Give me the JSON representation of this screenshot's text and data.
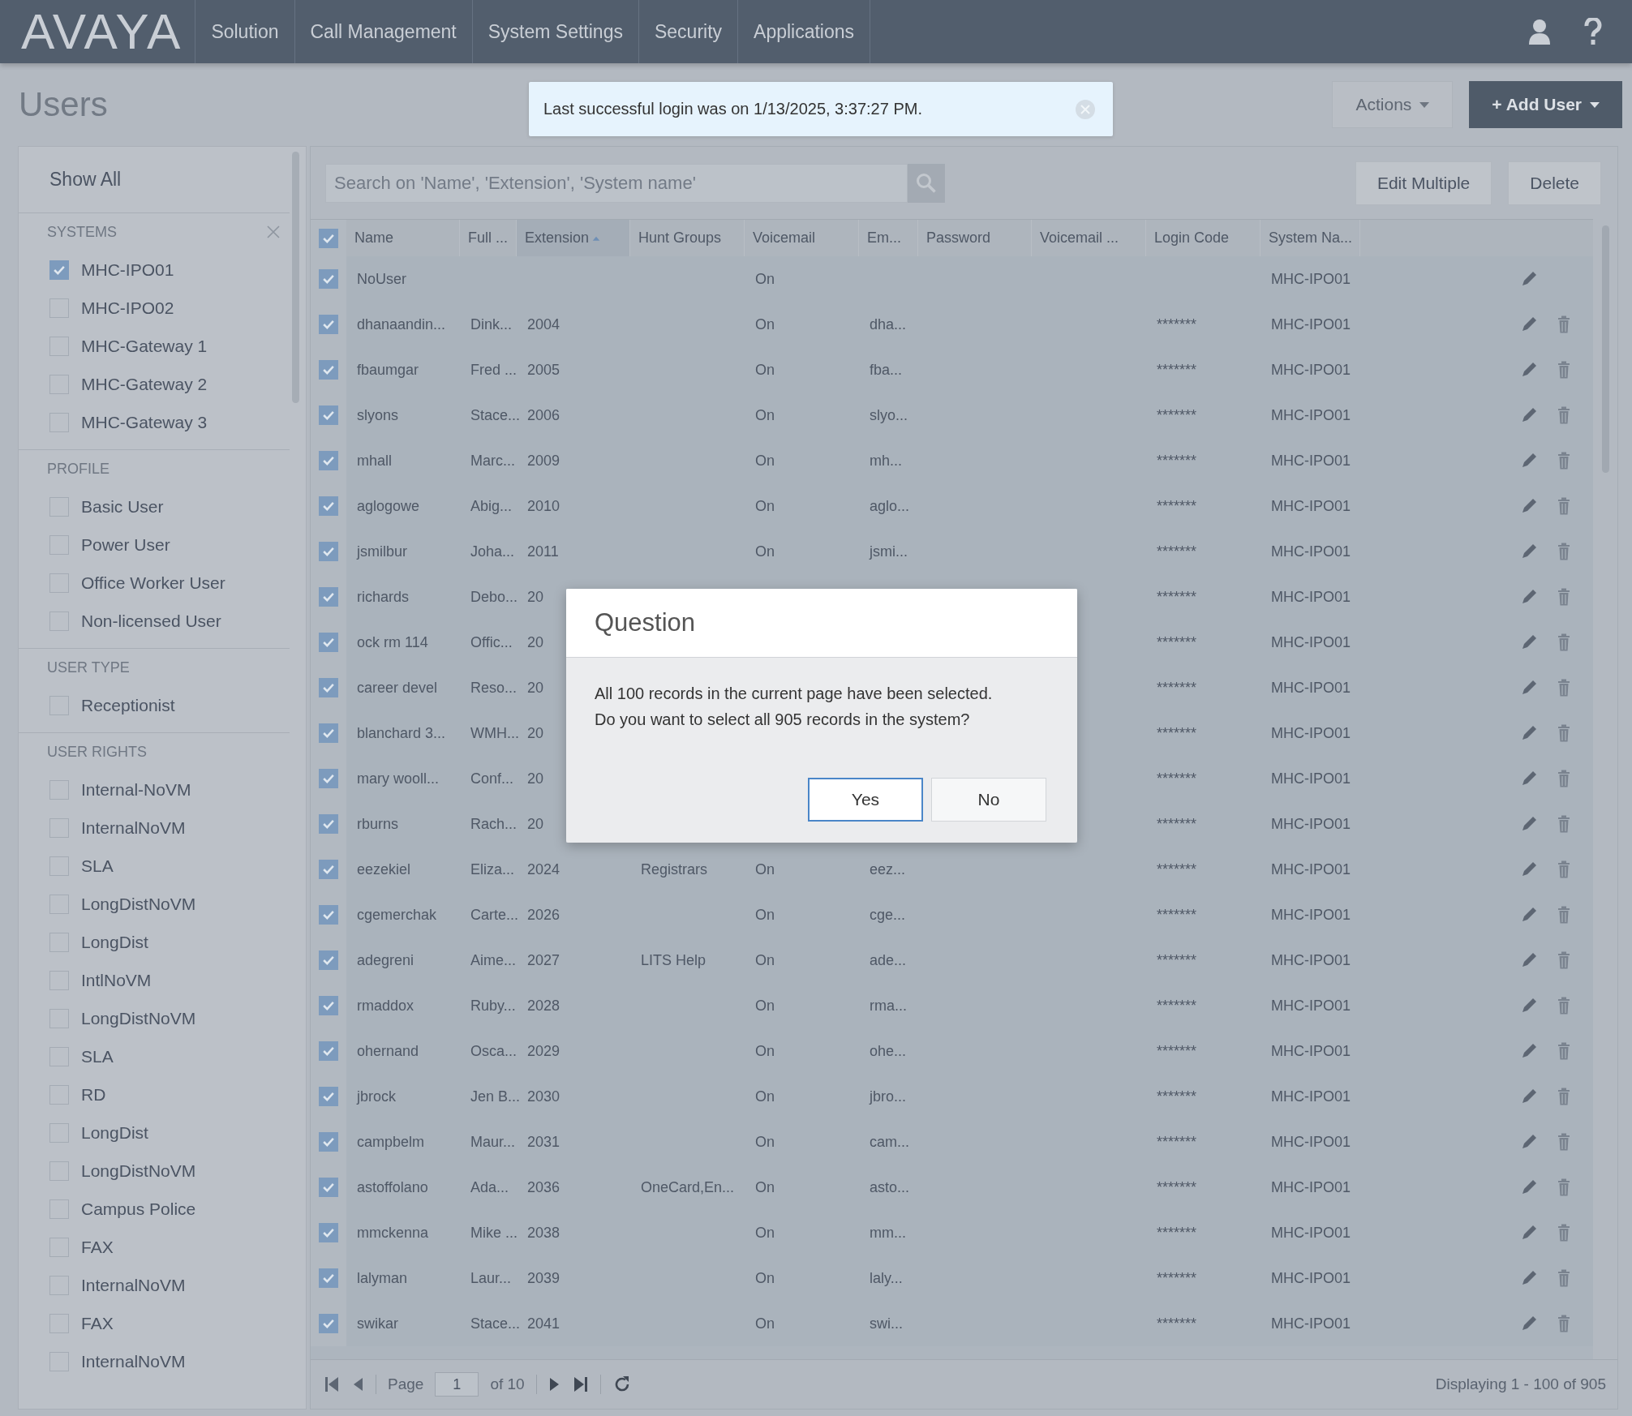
{
  "topbar": {
    "logo": "AVAYA",
    "nav": [
      {
        "label": "Solution"
      },
      {
        "label": "Call Management"
      },
      {
        "label": "System Settings"
      },
      {
        "label": "Security"
      },
      {
        "label": "Applications"
      }
    ]
  },
  "page_title": "Users",
  "notification": {
    "message": "Last successful login was on 1/13/2025, 3:37:27 PM."
  },
  "header_buttons": [
    {
      "label": "Actions",
      "kind": "secondary"
    },
    {
      "label": "+ Add User",
      "kind": "primary"
    }
  ],
  "sidebar": {
    "show_all": "Show All",
    "sections": [
      {
        "title": "SYSTEMS",
        "clearable": true,
        "items": [
          {
            "label": "MHC-IPO01",
            "checked": true
          },
          {
            "label": "MHC-IPO02",
            "checked": false
          },
          {
            "label": "MHC-Gateway 1",
            "checked": false
          },
          {
            "label": "MHC-Gateway 2",
            "checked": false
          },
          {
            "label": "MHC-Gateway 3",
            "checked": false
          }
        ]
      },
      {
        "title": "PROFILE",
        "clearable": false,
        "items": [
          {
            "label": "Basic User",
            "checked": false
          },
          {
            "label": "Power User",
            "checked": false
          },
          {
            "label": "Office Worker User",
            "checked": false
          },
          {
            "label": "Non-licensed User",
            "checked": false
          }
        ]
      },
      {
        "title": "USER TYPE",
        "clearable": false,
        "items": [
          {
            "label": "Receptionist",
            "checked": false
          }
        ]
      },
      {
        "title": "USER RIGHTS",
        "clearable": false,
        "items": [
          {
            "label": "Internal-NoVM",
            "checked": false
          },
          {
            "label": "InternalNoVM",
            "checked": false
          },
          {
            "label": "SLA",
            "checked": false
          },
          {
            "label": "LongDistNoVM",
            "checked": false
          },
          {
            "label": "LongDist",
            "checked": false
          },
          {
            "label": "IntlNoVM",
            "checked": false
          },
          {
            "label": "LongDistNoVM",
            "checked": false
          },
          {
            "label": "SLA",
            "checked": false
          },
          {
            "label": "RD",
            "checked": false
          },
          {
            "label": "LongDist",
            "checked": false
          },
          {
            "label": "LongDistNoVM",
            "checked": false
          },
          {
            "label": "Campus Police",
            "checked": false
          },
          {
            "label": "FAX",
            "checked": false
          },
          {
            "label": "InternalNoVM",
            "checked": false
          },
          {
            "label": "FAX",
            "checked": false
          },
          {
            "label": "InternalNoVM",
            "checked": false
          }
        ]
      }
    ]
  },
  "search": {
    "placeholder": "Search on 'Name', 'Extension', 'System name'"
  },
  "grid_buttons": [
    {
      "label": "Edit Multiple"
    },
    {
      "label": "Delete"
    }
  ],
  "table": {
    "all_selected": true,
    "columns": [
      {
        "label": "Name",
        "sorted_ascending": false
      },
      {
        "label": "Full ...",
        "sorted_ascending": false
      },
      {
        "label": "Extension",
        "sorted_ascending": true
      },
      {
        "label": "Hunt Groups",
        "sorted_ascending": false
      },
      {
        "label": "Voicemail",
        "sorted_ascending": false
      },
      {
        "label": "Em...",
        "sorted_ascending": false
      },
      {
        "label": "Password",
        "sorted_ascending": false
      },
      {
        "label": "Voicemail ...",
        "sorted_ascending": false
      },
      {
        "label": "Login Code",
        "sorted_ascending": false
      },
      {
        "label": "System Na...",
        "sorted_ascending": false
      }
    ],
    "rows": [
      {
        "selected": true,
        "deletable": false,
        "cells": [
          "NoUser",
          "",
          "",
          "",
          "On",
          "",
          "",
          "",
          "",
          "MHC-IPO01"
        ]
      },
      {
        "selected": true,
        "deletable": true,
        "cells": [
          "dhanaandin...",
          "Dink...",
          "2004",
          "",
          "On",
          "dha...",
          "",
          "",
          "*******",
          "MHC-IPO01"
        ]
      },
      {
        "selected": true,
        "deletable": true,
        "cells": [
          "fbaumgar",
          "Fred ...",
          "2005",
          "",
          "On",
          "fba...",
          "",
          "",
          "*******",
          "MHC-IPO01"
        ]
      },
      {
        "selected": true,
        "deletable": true,
        "cells": [
          "slyons",
          "Stace...",
          "2006",
          "",
          "On",
          "slyo...",
          "",
          "",
          "*******",
          "MHC-IPO01"
        ]
      },
      {
        "selected": true,
        "deletable": true,
        "cells": [
          "mhall",
          "Marc...",
          "2009",
          "",
          "On",
          "mh...",
          "",
          "",
          "*******",
          "MHC-IPO01"
        ]
      },
      {
        "selected": true,
        "deletable": true,
        "cells": [
          "aglogowe",
          "Abig...",
          "2010",
          "",
          "On",
          "aglo...",
          "",
          "",
          "*******",
          "MHC-IPO01"
        ]
      },
      {
        "selected": true,
        "deletable": true,
        "cells": [
          "jsmilbur",
          "Joha...",
          "2011",
          "",
          "On",
          "jsmi...",
          "",
          "",
          "*******",
          "MHC-IPO01"
        ]
      },
      {
        "selected": true,
        "deletable": true,
        "cells": [
          "richards",
          "Debo...",
          "20",
          "",
          "",
          "",
          "",
          "",
          "*******",
          "MHC-IPO01"
        ]
      },
      {
        "selected": true,
        "deletable": true,
        "cells": [
          "ock rm 114",
          "Offic...",
          "20",
          "",
          "",
          "",
          "",
          "",
          "*******",
          "MHC-IPO01"
        ]
      },
      {
        "selected": true,
        "deletable": true,
        "cells": [
          "career devel",
          "Reso...",
          "20",
          "",
          "",
          "",
          "",
          "",
          "*******",
          "MHC-IPO01"
        ]
      },
      {
        "selected": true,
        "deletable": true,
        "cells": [
          "blanchard 3...",
          "WMH...",
          "20",
          "",
          "",
          "",
          "",
          "",
          "*******",
          "MHC-IPO01"
        ]
      },
      {
        "selected": true,
        "deletable": true,
        "cells": [
          "mary wooll...",
          "Conf...",
          "20",
          "",
          "",
          "",
          "",
          "",
          "*******",
          "MHC-IPO01"
        ]
      },
      {
        "selected": true,
        "deletable": true,
        "cells": [
          "rburns",
          "Rach...",
          "20",
          "",
          "",
          "",
          "",
          "",
          "*******",
          "MHC-IPO01"
        ]
      },
      {
        "selected": true,
        "deletable": true,
        "cells": [
          "eezekiel",
          "Eliza...",
          "2024",
          "Registrars",
          "On",
          "eez...",
          "",
          "",
          "*******",
          "MHC-IPO01"
        ]
      },
      {
        "selected": true,
        "deletable": true,
        "cells": [
          "cgemerchak",
          "Carte...",
          "2026",
          "",
          "On",
          "cge...",
          "",
          "",
          "*******",
          "MHC-IPO01"
        ]
      },
      {
        "selected": true,
        "deletable": true,
        "cells": [
          "adegreni",
          "Aime...",
          "2027",
          "LITS Help",
          "On",
          "ade...",
          "",
          "",
          "*******",
          "MHC-IPO01"
        ]
      },
      {
        "selected": true,
        "deletable": true,
        "cells": [
          "rmaddox",
          "Ruby...",
          "2028",
          "",
          "On",
          "rma...",
          "",
          "",
          "*******",
          "MHC-IPO01"
        ]
      },
      {
        "selected": true,
        "deletable": true,
        "cells": [
          "ohernand",
          "Osca...",
          "2029",
          "",
          "On",
          "ohe...",
          "",
          "",
          "*******",
          "MHC-IPO01"
        ]
      },
      {
        "selected": true,
        "deletable": true,
        "cells": [
          "jbrock",
          "Jen B...",
          "2030",
          "",
          "On",
          "jbro...",
          "",
          "",
          "*******",
          "MHC-IPO01"
        ]
      },
      {
        "selected": true,
        "deletable": true,
        "cells": [
          "campbelm",
          "Maur...",
          "2031",
          "",
          "On",
          "cam...",
          "",
          "",
          "*******",
          "MHC-IPO01"
        ]
      },
      {
        "selected": true,
        "deletable": true,
        "cells": [
          "astoffolano",
          "Ada...",
          "2036",
          "OneCard,En...",
          "On",
          "asto...",
          "",
          "",
          "*******",
          "MHC-IPO01"
        ]
      },
      {
        "selected": true,
        "deletable": true,
        "cells": [
          "mmckenna",
          "Mike ...",
          "2038",
          "",
          "On",
          "mm...",
          "",
          "",
          "*******",
          "MHC-IPO01"
        ]
      },
      {
        "selected": true,
        "deletable": true,
        "cells": [
          "lalyman",
          "Laur...",
          "2039",
          "",
          "On",
          "laly...",
          "",
          "",
          "*******",
          "MHC-IPO01"
        ]
      },
      {
        "selected": true,
        "deletable": true,
        "cells": [
          "swikar",
          "Stace...",
          "2041",
          "",
          "On",
          "swi...",
          "",
          "",
          "*******",
          "MHC-IPO01"
        ]
      }
    ]
  },
  "pager": {
    "page_label": "Page",
    "page_value": "1",
    "of_label": "of 10",
    "summary": "Displaying 1 - 100 of 905"
  },
  "dialog": {
    "title": "Question",
    "message": "All 100 records in the current page have been selected.\nDo you want to select all 905 records in the system?",
    "buttons": [
      {
        "label": "Yes",
        "focused": true
      },
      {
        "label": "No",
        "focused": false
      }
    ]
  }
}
